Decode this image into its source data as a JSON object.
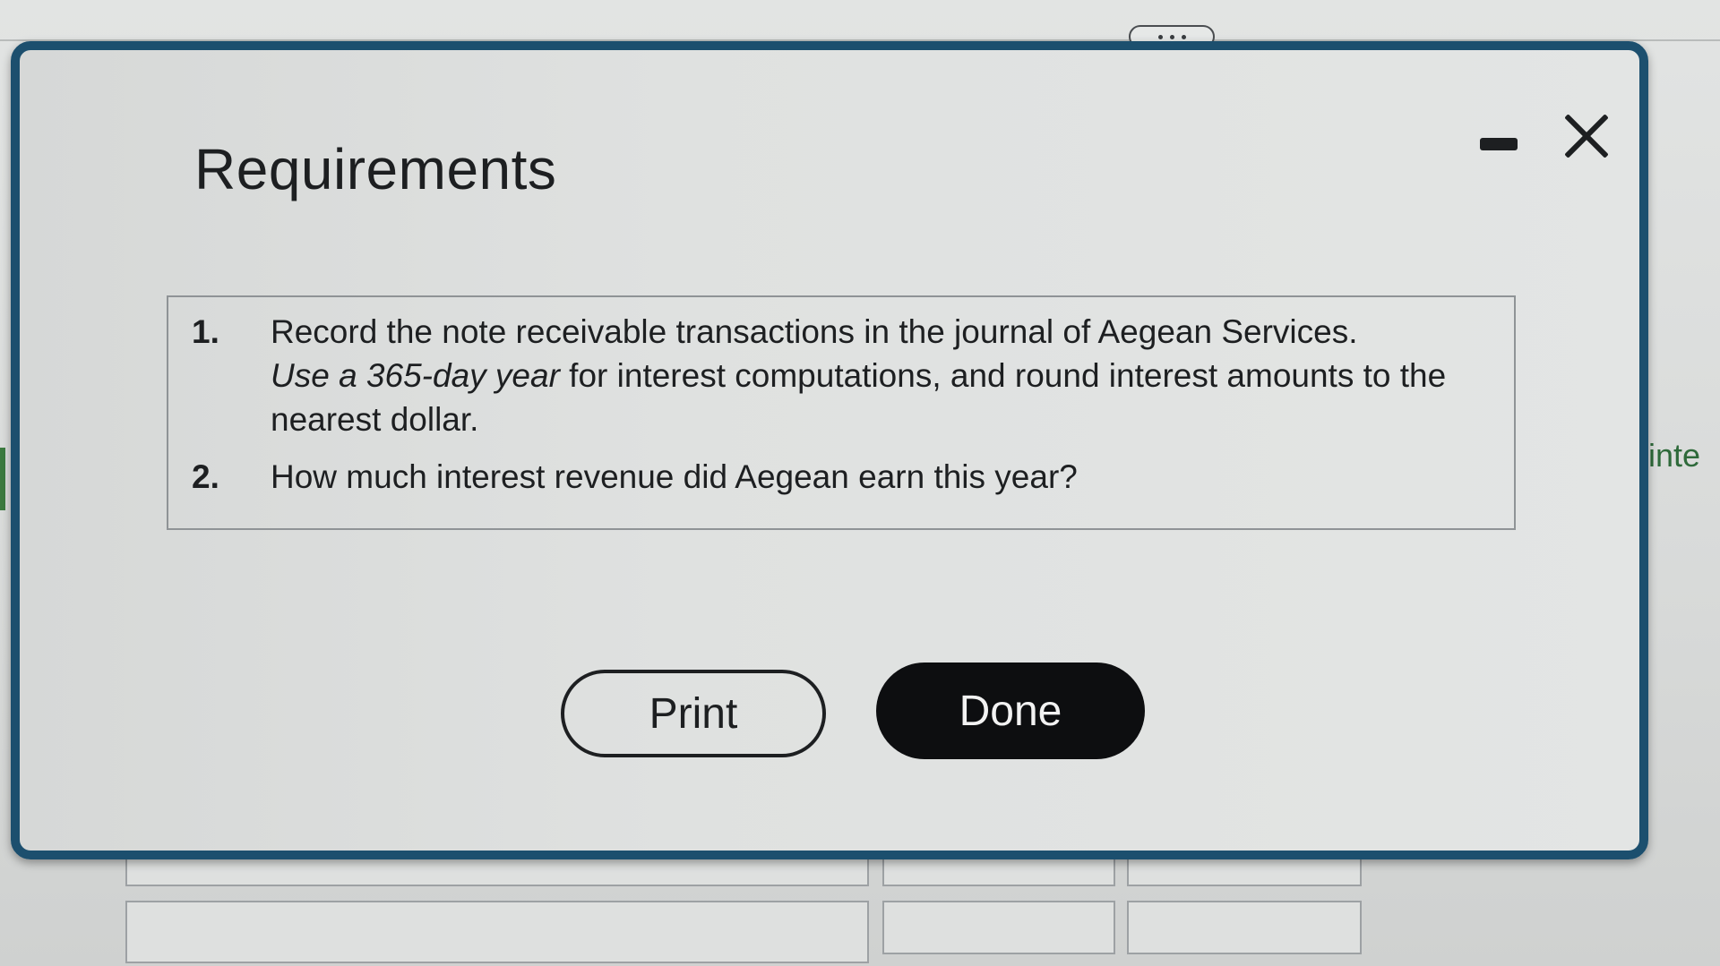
{
  "dialog": {
    "title": "Requirements",
    "requirements": [
      {
        "number": "1.",
        "text_part1": "Record the note receivable transactions in the journal of Aegean Services.",
        "text_italic": "Use a 365-day year",
        "text_part2": " for interest computations, and round interest amounts to the nearest dollar."
      },
      {
        "number": "2.",
        "text": "How much interest revenue did Aegean earn this year?"
      }
    ],
    "buttons": {
      "print_label": "Print",
      "done_label": "Done"
    },
    "icons": {
      "minimize": "minimize-icon",
      "close": "close-icon"
    }
  },
  "background": {
    "partial_text": "inte"
  },
  "colors": {
    "dialog_border": "#1c4f6e",
    "done_button_bg": "#0d0e10",
    "text": "#1d1f21",
    "background_accent_text": "#2e6a3a"
  }
}
